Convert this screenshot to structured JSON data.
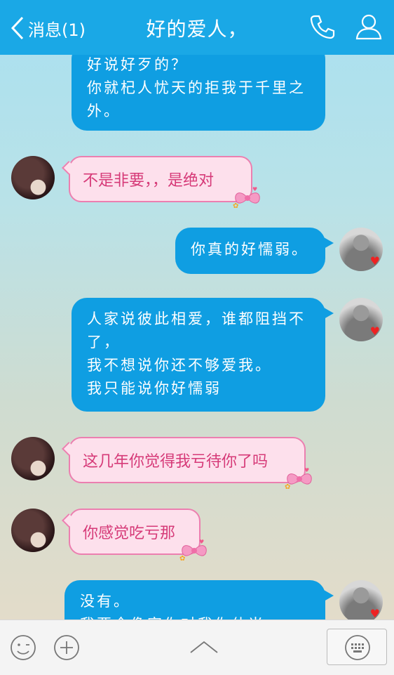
{
  "header": {
    "back_label": "消息(1)",
    "title": "好的爱人，",
    "call_icon": "phone-icon",
    "profile_icon": "person-icon"
  },
  "messages": [
    {
      "from": "me",
      "lines": [
        "好说好歹的？",
        "你就杞人忧天的拒我于千里之",
        "外。"
      ]
    },
    {
      "from": "them",
      "text": "不是非要，，是绝对"
    },
    {
      "from": "me",
      "lines": [
        "你真的好懦弱。"
      ]
    },
    {
      "from": "me",
      "lines": [
        "人家说彼此相爱，谁都阻挡不",
        "了，",
        "我不想说你还不够爱我。",
        "我只能说你好懦弱"
      ]
    },
    {
      "from": "them",
      "text": "这几年你觉得我亏待你了吗"
    },
    {
      "from": "them",
      "text": "你感觉吃亏那"
    },
    {
      "from": "me",
      "lines": [
        "没有。",
        "我要全像家你对我你什当"
      ]
    }
  ],
  "toolbar": {
    "emoji_icon": "smiley-icon",
    "plus_icon": "plus-icon",
    "expand_icon": "chevron-up-icon",
    "keyboard_icon": "keyboard-icon"
  },
  "colors": {
    "header": "#1aa8e6",
    "bubble_me": "#0f9ee2",
    "bubble_them_bg": "#fde0ec",
    "bubble_them_border": "#ec7fb0",
    "bubble_them_text": "#d63a78"
  }
}
